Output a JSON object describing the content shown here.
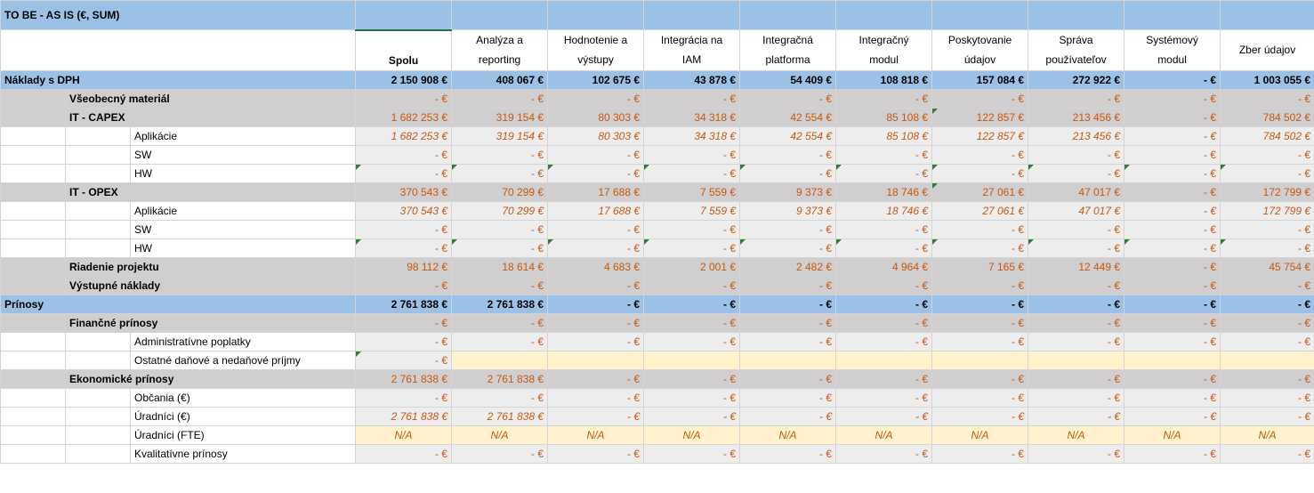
{
  "sheet_title": "TO BE - AS IS (€, SUM)",
  "columns": [
    {
      "l1": "",
      "l2": "Spolu"
    },
    {
      "l1": "Analýza a",
      "l2": "reporting"
    },
    {
      "l1": "Hodnotenie a",
      "l2": "výstupy"
    },
    {
      "l1": "Integrácia na",
      "l2": "IAM"
    },
    {
      "l1": "Integračná",
      "l2": "platforma"
    },
    {
      "l1": "Integračný",
      "l2": "modul"
    },
    {
      "l1": "Poskytovanie",
      "l2": "údajov"
    },
    {
      "l1": "Správa",
      "l2": "používateľov"
    },
    {
      "l1": "Systémový",
      "l2": "modul"
    },
    {
      "l1": "Zber údajov",
      "l2": ""
    }
  ],
  "rows": [
    {
      "level": 0,
      "label": "Náklady s DPH",
      "values": [
        "2 150 908 €",
        "408 067 €",
        "102 675 €",
        "43 878 €",
        "54 409 €",
        "108 818 €",
        "157 084 €",
        "272 922 €",
        "- €",
        "1 003 055 €"
      ]
    },
    {
      "level": 1,
      "label": "Všeobecný materiál",
      "values": [
        "- €",
        "- €",
        "- €",
        "- €",
        "- €",
        "- €",
        "- €",
        "- €",
        "- €",
        "- €"
      ]
    },
    {
      "level": 1,
      "label": "IT - CAPEX",
      "values": [
        "1 682 253 €",
        "319 154 €",
        "80 303 €",
        "34 318 €",
        "42 554 €",
        "85 108 €",
        "122 857 €",
        "213 456 €",
        "- €",
        "784 502 €"
      ]
    },
    {
      "level": 2,
      "italic": true,
      "label": "Aplikácie",
      "values": [
        "1 682 253 €",
        "319 154 €",
        "80 303 €",
        "34 318 €",
        "42 554 €",
        "85 108 €",
        "122 857 €",
        "213 456 €",
        "- €",
        "784 502 €"
      ]
    },
    {
      "level": 2,
      "label": "SW",
      "values": [
        "- €",
        "- €",
        "- €",
        "- €",
        "- €",
        "- €",
        "- €",
        "- €",
        "- €",
        "- €"
      ]
    },
    {
      "level": 2,
      "label": "HW",
      "values": [
        "- €",
        "- €",
        "- €",
        "- €",
        "- €",
        "- €",
        "- €",
        "- €",
        "- €",
        "- €"
      ]
    },
    {
      "level": 1,
      "label": "IT - OPEX",
      "values": [
        "370 543 €",
        "70 299 €",
        "17 688 €",
        "7 559 €",
        "9 373 €",
        "18 746 €",
        "27 061 €",
        "47 017 €",
        "- €",
        "172 799 €"
      ]
    },
    {
      "level": 2,
      "italic": true,
      "label": "Aplikácie",
      "values": [
        "370 543 €",
        "70 299 €",
        "17 688 €",
        "7 559 €",
        "9 373 €",
        "18 746 €",
        "27 061 €",
        "47 017 €",
        "- €",
        "172 799 €"
      ]
    },
    {
      "level": 2,
      "label": "SW",
      "values": [
        "- €",
        "- €",
        "- €",
        "- €",
        "- €",
        "- €",
        "- €",
        "- €",
        "- €",
        "- €"
      ]
    },
    {
      "level": 2,
      "label": "HW",
      "values": [
        "- €",
        "- €",
        "- €",
        "- €",
        "- €",
        "- €",
        "- €",
        "- €",
        "- €",
        "- €"
      ]
    },
    {
      "level": 1,
      "label": "Riadenie projektu",
      "values": [
        "98 112 €",
        "18 614 €",
        "4 683 €",
        "2 001 €",
        "2 482 €",
        "4 964 €",
        "7 165 €",
        "12 449 €",
        "- €",
        "45 754 €"
      ]
    },
    {
      "level": 1,
      "label": "Výstupné náklady",
      "values": [
        "- €",
        "- €",
        "- €",
        "- €",
        "- €",
        "- €",
        "- €",
        "- €",
        "- €",
        "- €"
      ]
    },
    {
      "level": 0,
      "label": "Prínosy",
      "values": [
        "2 761 838 €",
        "2 761 838 €",
        "- €",
        "- €",
        "- €",
        "- €",
        "- €",
        "- €",
        "- €",
        "- €"
      ]
    },
    {
      "level": 1,
      "label": "Finančné prínosy",
      "values": [
        "- €",
        "- €",
        "- €",
        "- €",
        "- €",
        "- €",
        "- €",
        "- €",
        "- €",
        "- €"
      ]
    },
    {
      "level": 2,
      "label": "Administratívne poplatky",
      "values": [
        "- €",
        "- €",
        "- €",
        "- €",
        "- €",
        "- €",
        "- €",
        "- €",
        "- €",
        "- €"
      ]
    },
    {
      "level": 2,
      "label": "Ostatné daňové a nedaňové príjmy",
      "values": [
        "- €",
        "",
        "",
        "",
        "",
        "",
        "",
        "",
        "",
        ""
      ]
    },
    {
      "level": 1,
      "label": "Ekonomické prínosy",
      "values": [
        "2 761 838 €",
        "2 761 838 €",
        "- €",
        "- €",
        "- €",
        "- €",
        "- €",
        "- €",
        "- €",
        "- €"
      ]
    },
    {
      "level": 2,
      "label": "Občania (€)",
      "values": [
        "- €",
        "- €",
        "- €",
        "- €",
        "- €",
        "- €",
        "- €",
        "- €",
        "- €",
        "- €"
      ]
    },
    {
      "level": 2,
      "italic": true,
      "label": "Úradníci (€)",
      "values": [
        "2 761 838 €",
        "2 761 838 €",
        "- €",
        "- €",
        "- €",
        "- €",
        "- €",
        "- €",
        "- €",
        "- €"
      ]
    },
    {
      "level": 2,
      "na": true,
      "label": "Úradníci (FTE)",
      "values": [
        "N/A",
        "N/A",
        "N/A",
        "N/A",
        "N/A",
        "N/A",
        "N/A",
        "N/A",
        "N/A",
        "N/A"
      ]
    },
    {
      "level": 2,
      "label": "Kvalitatívne prínosy",
      "values": [
        "- €",
        "- €",
        "- €",
        "- €",
        "- €",
        "- €",
        "- €",
        "- €",
        "- €",
        "- €"
      ]
    }
  ]
}
